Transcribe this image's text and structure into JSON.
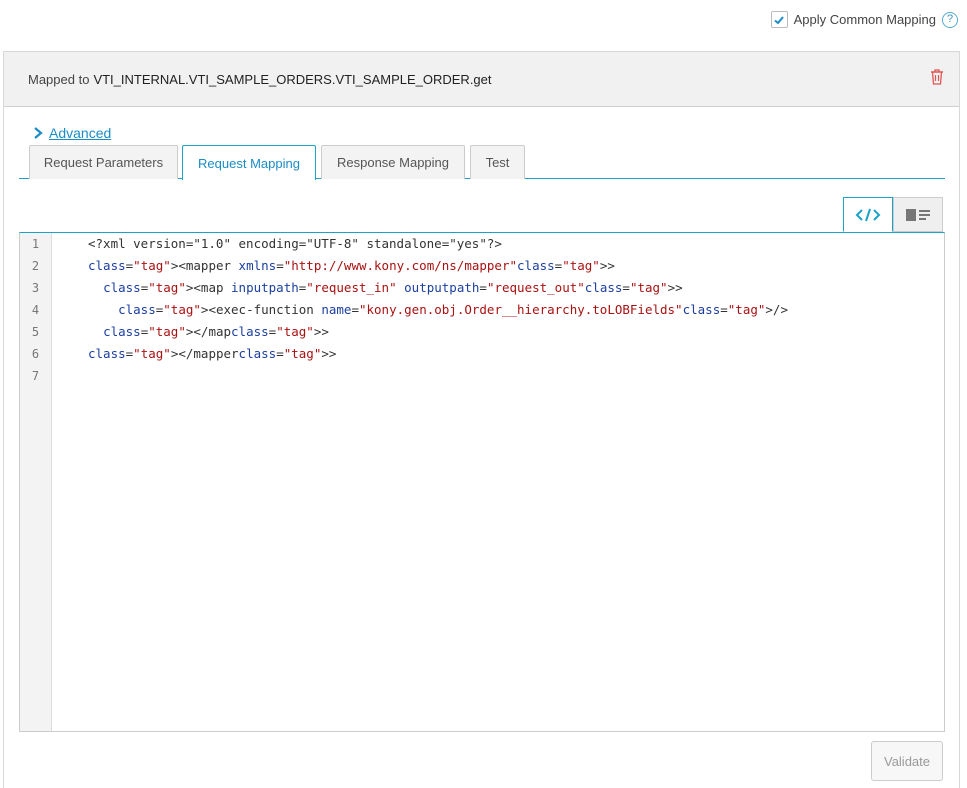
{
  "top": {
    "apply_common_mapping_label": "Apply Common Mapping",
    "apply_common_mapping_checked": true,
    "help_glyph": "?"
  },
  "header": {
    "mapped_prefix": "Mapped to",
    "mapped_target": "VTI_INTERNAL.VTI_SAMPLE_ORDERS.VTI_SAMPLE_ORDER.get"
  },
  "advanced": {
    "label": "Advanced"
  },
  "tabs": [
    {
      "label": "Request Parameters",
      "active": false
    },
    {
      "label": "Request Mapping",
      "active": true
    },
    {
      "label": "Response Mapping",
      "active": false
    },
    {
      "label": "Test",
      "active": false
    }
  ],
  "view_toggle": {
    "code_view_icon": "code-icon",
    "form_view_icon": "list-view-icon",
    "active": "code"
  },
  "editor": {
    "line_numbers": [
      "1",
      "2",
      "3",
      "4",
      "5",
      "6",
      "7"
    ],
    "lines": [
      "<?xml version=\"1.0\" encoding=\"UTF-8\" standalone=\"yes\"?>",
      "<mapper xmlns=\"http://www.kony.com/ns/mapper\">",
      "  <map inputpath=\"request_in\" outputpath=\"request_out\">",
      "    <exec-function name=\"kony.gen.obj.Order__hierarchy.toLOBFields\"/>",
      "  </map>",
      "</mapper>",
      ""
    ]
  },
  "footer": {
    "validate_label": "Validate"
  },
  "colors": {
    "accent": "#1aa3c9",
    "link": "#1a8cc7",
    "delete": "#e05555"
  }
}
